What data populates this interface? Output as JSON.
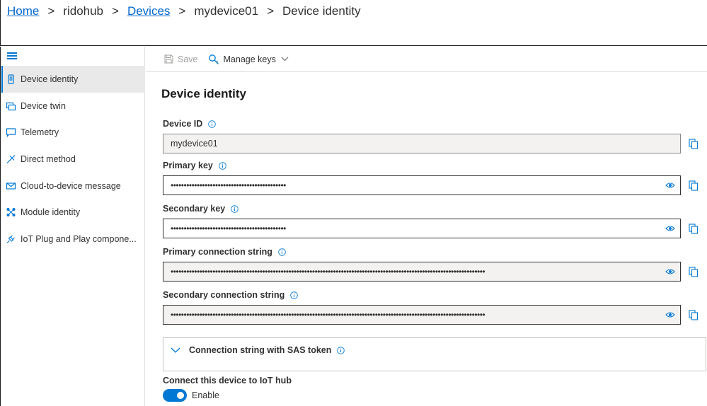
{
  "breadcrumb": {
    "items": [
      {
        "label": "Home",
        "link": true
      },
      {
        "label": "ridohub",
        "link": false
      },
      {
        "label": "Devices",
        "link": true
      },
      {
        "label": "mydevice01",
        "link": false
      },
      {
        "label": "Device identity",
        "link": false
      }
    ],
    "separator": ">"
  },
  "sidebar": {
    "items": [
      {
        "label": "Device identity",
        "icon": "device-icon",
        "active": true
      },
      {
        "label": "Device twin",
        "icon": "device-twin-icon",
        "active": false
      },
      {
        "label": "Telemetry",
        "icon": "chat-icon",
        "active": false
      },
      {
        "label": "Direct method",
        "icon": "direct-method-icon",
        "active": false
      },
      {
        "label": "Cloud-to-device message",
        "icon": "mail-icon",
        "active": false
      },
      {
        "label": "Module identity",
        "icon": "module-icon",
        "active": false
      },
      {
        "label": "IoT Plug and Play compone...",
        "icon": "plug-icon",
        "active": false
      }
    ]
  },
  "toolbar": {
    "save_label": "Save",
    "manage_keys_label": "Manage keys"
  },
  "main": {
    "title": "Device identity",
    "fields": {
      "device_id": {
        "label": "Device ID",
        "value": "mydevice01"
      },
      "primary_key": {
        "label": "Primary key",
        "value": "••••••••••••••••••••••••••••••••••••••••••••"
      },
      "secondary_key": {
        "label": "Secondary key",
        "value": "••••••••••••••••••••••••••••••••••••••••••••"
      },
      "primary_conn": {
        "label": "Primary connection string",
        "value": "••••••••••••••••••••••••••••••••••••••••••••••••••••••••••••••••••••••••••••••••••••••••••••••••••••••••••••••••••••••••"
      },
      "secondary_conn": {
        "label": "Secondary connection string",
        "value": "••••••••••••••••••••••••••••••••••••••••••••••••••••••••••••••••••••••••••••••••••••••••••••••••••••••••••••••••••••••••"
      }
    },
    "sas_section": {
      "label": "Connection string with SAS token"
    },
    "connect": {
      "label": "Connect this device to IoT hub",
      "toggle_label": "Enable",
      "enabled": true
    }
  },
  "colors": {
    "accent": "#0078d4",
    "link": "#0066cc"
  }
}
